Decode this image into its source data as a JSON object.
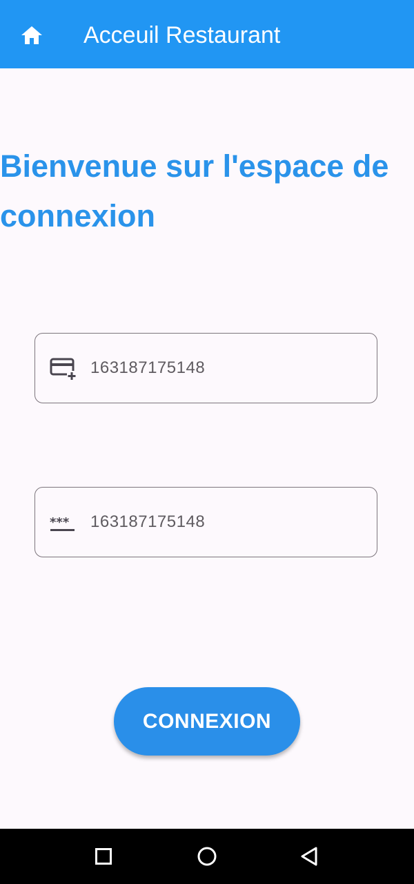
{
  "app_bar": {
    "title": "Acceuil Restaurant",
    "home_icon": "home-icon",
    "background": "#2196f3"
  },
  "heading": {
    "text": "Bienvenue sur l'espace de connexion",
    "color": "#2a93ea"
  },
  "fields": [
    {
      "icon": "credit-card-add-icon",
      "value": "163187175148"
    },
    {
      "icon": "password-icon",
      "value": "163187175148"
    }
  ],
  "connect_button": {
    "label": "CONNEXION",
    "color": "#2a8fe9"
  },
  "system_nav": {
    "buttons": [
      "recents-square-icon",
      "home-circle-icon",
      "back-triangle-icon"
    ]
  }
}
